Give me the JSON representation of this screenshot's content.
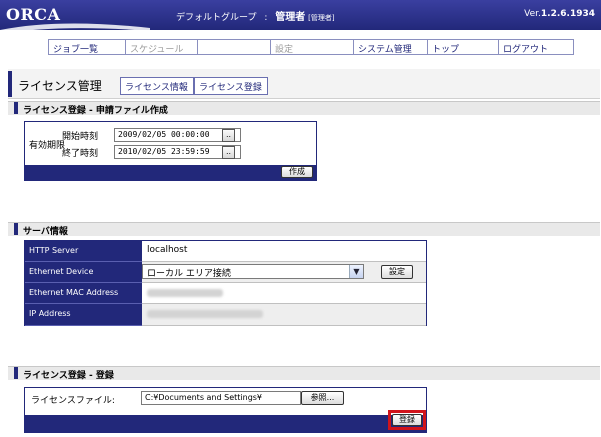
{
  "header": {
    "logo": "ORCA",
    "group": "デフォルトグループ",
    "separator": ":",
    "user": "管理者",
    "role": "[管理者]",
    "version_prefix": "Ver.",
    "version": "1.2.6.1934"
  },
  "nav": {
    "items": [
      {
        "label": "ジョブ一覧",
        "enabled": true
      },
      {
        "label": "スケジュール",
        "enabled": false
      },
      {
        "label": "",
        "enabled": false
      },
      {
        "label": "設定",
        "enabled": false
      },
      {
        "label": "システム管理",
        "enabled": true
      },
      {
        "label": "トップ",
        "enabled": true
      },
      {
        "label": "ログアウト",
        "enabled": true
      }
    ]
  },
  "page": {
    "title": "ライセンス管理",
    "tabs": [
      "ライセンス情報",
      "ライセンス登録"
    ]
  },
  "section_application": {
    "title": "ライセンス登録 - 申請ファイル作成",
    "period_label": "有効期限",
    "start_label": "開始時刻",
    "start_value": "2009/02/05 00:00:00",
    "end_label": "終了時刻",
    "end_value": "2010/02/05 23:59:59",
    "picker_label": "..",
    "create_button": "作成"
  },
  "section_server": {
    "title": "サーバ情報",
    "http_label": "HTTP Server",
    "http_value": "localhost",
    "device_label": "Ethernet Device",
    "device_value": "ローカル エリア接続",
    "device_button": "設定",
    "mac_label": "Ethernet MAC Address",
    "ip_label": "IP Address"
  },
  "section_register": {
    "title": "ライセンス登録 - 登録",
    "file_label": "ライセンスファイル:",
    "file_value": "C:¥Documents and Settings¥",
    "browse_button": "参照...",
    "register_button": "登録"
  },
  "colors": {
    "brand": "#22287a",
    "highlight": "#d1141b"
  }
}
